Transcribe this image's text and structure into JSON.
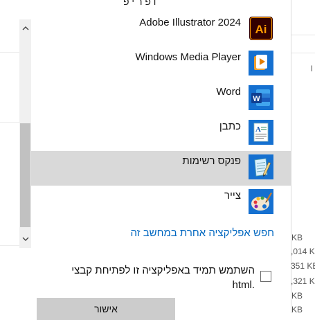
{
  "background": {
    "right_glyph": "l",
    "sizes": [
      "KB",
      ",014 KB",
      "351 KB",
      ",321 KB",
      "KB",
      "KB"
    ]
  },
  "dialog": {
    "top_partial_text": "ו  פ  ר  י  פ",
    "apps": [
      {
        "name": "Adobe Illustrator 2024",
        "icon": "adobe-illustrator-icon",
        "selected": false
      },
      {
        "name": "Windows Media Player",
        "icon": "windows-media-player-icon",
        "selected": false
      },
      {
        "name": "Word",
        "icon": "word-icon",
        "selected": false
      },
      {
        "name": "כתבן",
        "icon": "wordpad-icon",
        "selected": false
      },
      {
        "name": "פנקס רשימות",
        "icon": "notepad-icon",
        "selected": true
      },
      {
        "name": "צייר",
        "icon": "paint-icon",
        "selected": false
      }
    ],
    "find_other_link": "חפש אפליקציה אחרת במחשב זה",
    "always_use_label": "השתמש תמיד באפליקציה זו לפתיחת קבצי .html",
    "always_use_checked": false,
    "ok_label": "אישור"
  },
  "scrollbar": {
    "up_glyph": "⌃",
    "down_glyph": "⌄"
  },
  "colors": {
    "link": "#0067c0",
    "selected_row": "#d9d9d9",
    "button": "#cccccc"
  }
}
